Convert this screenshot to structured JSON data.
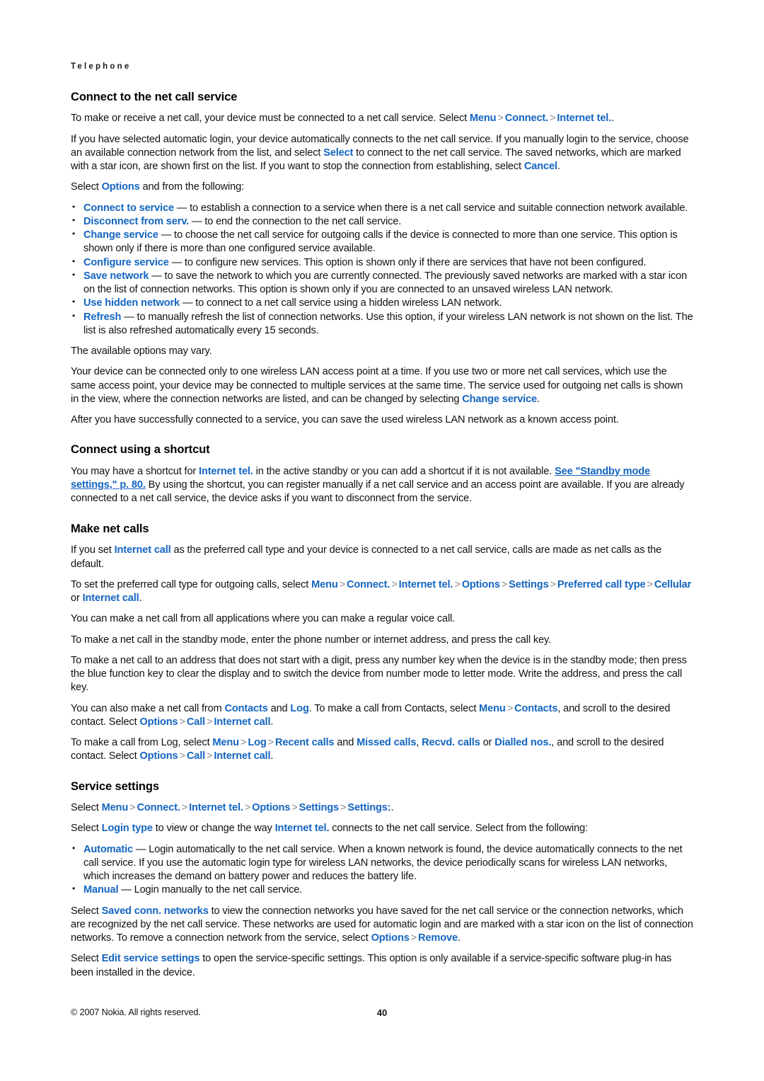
{
  "running_head": "Telephone",
  "sections": [
    {
      "heading": "Connect to the net call service",
      "paragraphs": {
        "p1_a": "To make or receive a net call, your device must be connected to a net call service. Select ",
        "p1_menu": "Menu",
        "p1_connect": "Connect.",
        "p1_internet_tel": "Internet tel.",
        "p1_end": ".",
        "p2": "If you have selected automatic login, your device automatically connects to the net call service. If you manually login to the service, choose an available connection network from the list, and select ",
        "p2_select": "Select",
        "p2_b": " to connect to the net call service. The saved networks, which are marked with a star icon, are shown first on the list. If you want to stop the connection from establishing, select ",
        "p2_cancel": "Cancel",
        "p2_end": ".",
        "p3_a": "Select ",
        "p3_options": "Options",
        "p3_b": " and from the following:",
        "after_list": "The available options may vary.",
        "p4_a": "Your device can be connected only to one wireless LAN access point at a time. If you use two or more net call services, which use the same access point, your device may be connected to multiple services at the same time. The service used for outgoing net calls is shown in the view, where the connection networks are listed, and can be changed by selecting ",
        "p4_change_service": "Change service",
        "p4_end": ".",
        "p5": "After you have successfully connected to a service, you can save the used wireless LAN network as a known access point."
      },
      "bullets": [
        {
          "term": "Connect to service",
          "text": "  — to establish a connection to a service when there is a net call service and suitable connection network available."
        },
        {
          "term": "Disconnect from serv.",
          "text": " — to end the connection to the net call service."
        },
        {
          "term": "Change service",
          "text": " — to choose the net call service for outgoing calls if the device is connected to more than one service. This option is shown only if there is more than one configured service available."
        },
        {
          "term": "Configure service",
          "text": " — to configure new services. This option is shown only if there are services that have not been configured."
        },
        {
          "term": "Save network",
          "text": " — to save the network to which you are currently connected. The previously saved networks are marked with a star icon on the list of connection networks. This option is shown only if you are connected to an unsaved wireless LAN network."
        },
        {
          "term": "Use hidden network",
          "text": " — to connect to a net call service using a hidden wireless LAN network."
        },
        {
          "term": "Refresh",
          "text": " — to manually refresh the list of connection networks. Use this option, if your wireless LAN network is not shown on the list. The list is also refreshed automatically every 15 seconds."
        }
      ]
    },
    {
      "heading": "Connect using a shortcut",
      "paragraphs": {
        "p1_a": "You may have a shortcut for ",
        "p1_internet_tel": "Internet tel.",
        "p1_b": " in the active standby or you can add a shortcut if it is not available. ",
        "p1_link": "See \"Standby mode settings,\" p. 80.",
        "p1_c": " By using the shortcut, you can register manually if a net call service and an access point are available. If you are already connected to a net call service, the device asks if you want to disconnect from the service."
      }
    },
    {
      "heading": "Make net calls",
      "paragraphs": {
        "p1_a": "If you set ",
        "p1_internet_call": "Internet call",
        "p1_b": " as the preferred call type and your device is connected to a net call service, calls are made as net calls as the default.",
        "p2_a": "To set the preferred call type for outgoing calls, select ",
        "p2_menu": "Menu",
        "p2_connect": "Connect.",
        "p2_internet_tel": "Internet tel.",
        "p2_options": "Options",
        "p2_settings": "Settings",
        "p2_preferred_call_type": "Preferred call type",
        "p2_cellular": "Cellular",
        "p2_or": " or ",
        "p2_internet_call": "Internet call",
        "p2_end": ".",
        "p3": "You can make a net call from all applications where you can make a regular voice call.",
        "p4": "To make a net call in the standby mode, enter the phone number or internet address, and press the call key.",
        "p5": "To make a net call to an address that does not start with a digit, press any number key when the device is in the standby mode; then press the blue function key to clear the display and to switch the device from number mode to letter mode. Write the address, and press the call key.",
        "p6_a": "You can also make a net call from ",
        "p6_contacts": "Contacts",
        "p6_and": " and ",
        "p6_log": "Log",
        "p6_b": ". To make a call from Contacts, select ",
        "p6_menu": "Menu",
        "p6_contacts2": "Contacts",
        "p6_c": ", and scroll to the desired contact. Select ",
        "p6_options": "Options",
        "p6_call": "Call",
        "p6_internet_call": "Internet call",
        "p6_end": ".",
        "p7_a": "To make a call from Log, select ",
        "p7_menu": "Menu",
        "p7_log": "Log",
        "p7_recent_calls": "Recent calls",
        "p7_and": " and ",
        "p7_missed_calls": "Missed calls",
        "p7_comma": ", ",
        "p7_recvd_calls": "Recvd. calls",
        "p7_or": " or ",
        "p7_dialled_nos": "Dialled nos.",
        "p7_b": ", and scroll to the desired contact. Select ",
        "p7_options": "Options",
        "p7_call": "Call",
        "p7_internet_call": "Internet call",
        "p7_end": "."
      }
    },
    {
      "heading": "Service settings",
      "paragraphs": {
        "p1_a": "Select ",
        "p1_menu": "Menu",
        "p1_connect": "Connect.",
        "p1_internet_tel": "Internet tel.",
        "p1_options": "Options",
        "p1_settings": "Settings",
        "p1_settings2": "Settings:",
        "p1_end": ".",
        "p2_a": "Select ",
        "p2_login_type": "Login type",
        "p2_b": " to view or change the way ",
        "p2_internet_tel": "Internet tel.",
        "p2_c": " connects to the net call service. Select from the following:",
        "p3_a": "Select ",
        "p3_saved_conn": "Saved conn. networks",
        "p3_b": " to view the connection networks you have saved for the net call service or the connection networks, which are recognized by the net call service. These networks are used for automatic login and are marked with a star icon on the list of connection networks. To remove a connection network from the service, select ",
        "p3_options": "Options",
        "p3_remove": "Remove",
        "p3_end": ".",
        "p4_a": "Select ",
        "p4_edit_service": "Edit service settings",
        "p4_b": " to open the service-specific settings. This option is only available if a service-specific software plug-in has been installed in the device."
      },
      "bullets": [
        {
          "term": "Automatic",
          "text": " — Login automatically to the net call service. When a known network is found, the device automatically connects to the net call service. If you use the automatic login type for wireless LAN networks, the device periodically scans for wireless LAN networks, which increases the demand on battery power and reduces the battery life."
        },
        {
          "term": "Manual",
          "text": " —  Login manually to the net call service."
        }
      ]
    }
  ],
  "footer": {
    "copyright": "© 2007 Nokia. All rights reserved.",
    "page_number": "40"
  },
  "colors": {
    "ui_term": "#1565c0",
    "separator": "#8a8a8a",
    "text": "#111111"
  }
}
